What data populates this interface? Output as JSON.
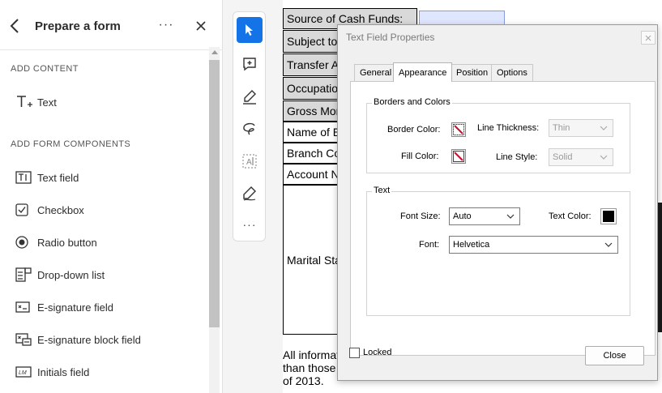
{
  "left_panel": {
    "title": "Prepare a form",
    "more_label": "···",
    "sections": {
      "add_content": "ADD CONTENT",
      "add_form_components": "ADD FORM COMPONENTS"
    },
    "content_items": [
      {
        "label": "Text",
        "icon": "text-tool-icon"
      }
    ],
    "component_items": [
      {
        "label": "Text field",
        "icon": "text-field-icon"
      },
      {
        "label": "Checkbox",
        "icon": "checkbox-icon"
      },
      {
        "label": "Radio button",
        "icon": "radio-button-icon"
      },
      {
        "label": "Drop-down list",
        "icon": "dropdown-list-icon"
      },
      {
        "label": "E-signature field",
        "icon": "esignature-field-icon"
      },
      {
        "label": "E-signature block field",
        "icon": "esignature-block-icon"
      },
      {
        "label": "Initials field",
        "icon": "initials-field-icon"
      }
    ]
  },
  "toolbar": {
    "tools": [
      "select-tool-icon",
      "add-comment-icon",
      "highlight-icon",
      "draw-freeform-icon",
      "text-field-tool-icon",
      "fill-sign-icon"
    ],
    "more_label": "···"
  },
  "document": {
    "rows": [
      "Source of Cash Funds:",
      "Subject to",
      "Transfer A",
      "Occupatio",
      "Gross Mon",
      "Name of E",
      "Branch Co",
      "Account N",
      "Marital Sta"
    ],
    "footer_lines": [
      "All informat",
      "than those",
      "of 2013."
    ]
  },
  "dialog": {
    "title": "Text Field Properties",
    "tabs": [
      "General",
      "Appearance",
      "Position",
      "Options"
    ],
    "active_tab": "Appearance",
    "borders_colors": {
      "group_label": "Borders and Colors",
      "border_color_label": "Border Color:",
      "line_thickness_label": "Line Thickness:",
      "line_thickness_value": "Thin",
      "fill_color_label": "Fill Color:",
      "line_style_label": "Line Style:",
      "line_style_value": "Solid"
    },
    "text": {
      "group_label": "Text",
      "font_size_label": "Font Size:",
      "font_size_value": "Auto",
      "text_color_label": "Text Color:",
      "text_color": "#000000",
      "font_label": "Font:",
      "font_value": "Helvetica"
    },
    "locked_label": "Locked",
    "close_label": "Close"
  },
  "colors": {
    "accent": "#1473e6",
    "no_color_slash": "#c8102e"
  }
}
